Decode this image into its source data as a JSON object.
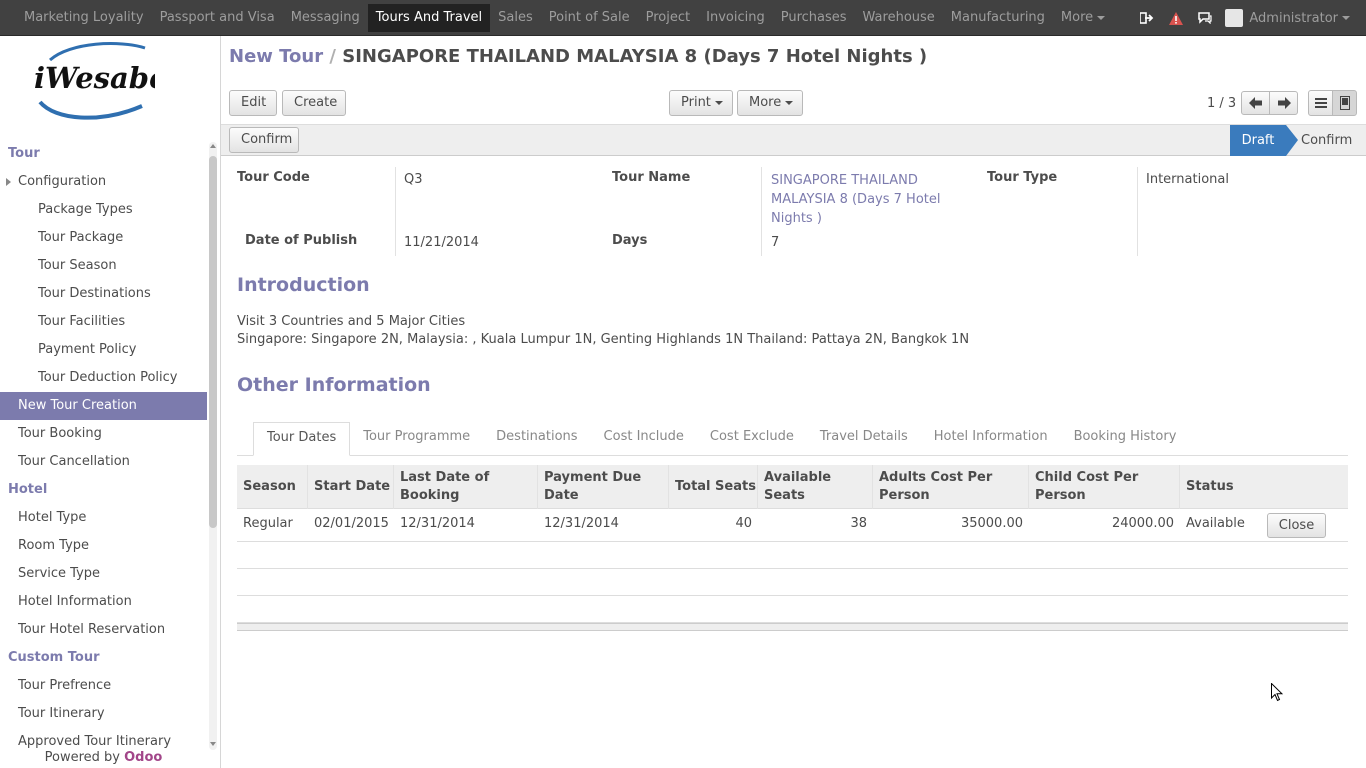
{
  "topbar": {
    "menu": [
      "Marketing Loyality",
      "Passport and Visa",
      "Messaging",
      "Tours And Travel",
      "Sales",
      "Point of Sale",
      "Project",
      "Invoicing",
      "Purchases",
      "Warehouse",
      "Manufacturing",
      "More"
    ],
    "active": "Tours And Travel",
    "user": "Administrator"
  },
  "sidebar": {
    "logo_text": "iWesabe",
    "sections": [
      {
        "heading": "Tour",
        "items": [
          {
            "label": "Configuration",
            "kind": "parent"
          },
          {
            "label": "Package Types",
            "kind": "sub"
          },
          {
            "label": "Tour Package",
            "kind": "sub"
          },
          {
            "label": "Tour Season",
            "kind": "sub"
          },
          {
            "label": "Tour Destinations",
            "kind": "sub"
          },
          {
            "label": "Tour Facilities",
            "kind": "sub"
          },
          {
            "label": "Payment Policy",
            "kind": "sub"
          },
          {
            "label": "Tour Deduction Policy",
            "kind": "sub"
          },
          {
            "label": "New Tour Creation",
            "kind": "active"
          },
          {
            "label": "Tour Booking",
            "kind": "item"
          },
          {
            "label": "Tour Cancellation",
            "kind": "item"
          }
        ]
      },
      {
        "heading": "Hotel",
        "items": [
          {
            "label": "Hotel Type",
            "kind": "item"
          },
          {
            "label": "Room Type",
            "kind": "item"
          },
          {
            "label": "Service Type",
            "kind": "item"
          },
          {
            "label": "Hotel Information",
            "kind": "item"
          },
          {
            "label": "Tour Hotel Reservation",
            "kind": "item"
          }
        ]
      },
      {
        "heading": "Custom Tour",
        "items": [
          {
            "label": "Tour Prefrence",
            "kind": "item"
          },
          {
            "label": "Tour Itinerary",
            "kind": "item"
          },
          {
            "label": "Approved Tour Itinerary",
            "kind": "item"
          }
        ]
      }
    ],
    "powered_prefix": "Powered by",
    "powered_brand": "Odoo"
  },
  "breadcrumb": {
    "parent": "New Tour",
    "separator": "/",
    "current": "SINGAPORE THAILAND MALAYSIA 8 (Days 7 Hotel Nights )"
  },
  "toolbar": {
    "edit": "Edit",
    "create": "Create",
    "print": "Print",
    "more": "More",
    "pager": "1 / 3"
  },
  "status": {
    "confirm_button": "Confirm",
    "stages": [
      "Draft",
      "Confirm"
    ],
    "current_stage": "Draft",
    "stage_color": "#3a7bbd"
  },
  "form": {
    "tour_code_label": "Tour Code",
    "tour_code": "Q3",
    "tour_name_label": "Tour Name",
    "tour_name": "SINGAPORE THAILAND MALAYSIA 8 (Days 7 Hotel Nights )",
    "tour_type_label": "Tour Type",
    "tour_type": "International",
    "date_label": "Date of Publish",
    "date": "11/21/2014",
    "days_label": "Days",
    "days": "7"
  },
  "intro": {
    "heading": "Introduction",
    "line1": "Visit 3 Countries and 5 Major Cities",
    "line2": "Singapore: Singapore 2N, Malaysia: , Kuala Lumpur 1N, Genting Highlands 1N Thailand: Pattaya 2N, Bangkok 1N"
  },
  "other_heading": "Other Information",
  "tabs": [
    "Tour Dates",
    "Tour Programme",
    "Destinations",
    "Cost Include",
    "Cost Exclude",
    "Travel Details",
    "Hotel Information",
    "Booking History"
  ],
  "active_tab": "Tour Dates",
  "table": {
    "headers": [
      "Season",
      "Start Date",
      "Last Date of Booking",
      "Payment Due Date",
      "Total Seats",
      "Available Seats",
      "Adults Cost Per Person",
      "Child Cost Per Person",
      "Status"
    ],
    "rows": [
      [
        "Regular",
        "02/01/2015",
        "12/31/2014",
        "12/31/2014",
        "40",
        "38",
        "35000.00",
        "24000.00",
        "Available"
      ]
    ],
    "row_button": "Close"
  },
  "colors": {
    "accent": "#7c7bad",
    "topbar": "#414141",
    "brand": "#a24689",
    "alert": "#d9534f"
  }
}
